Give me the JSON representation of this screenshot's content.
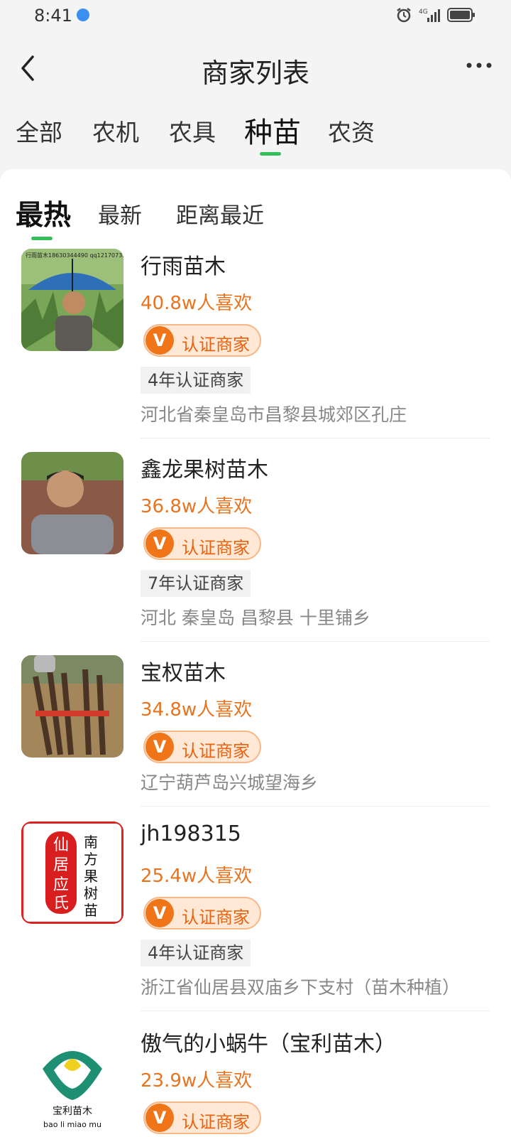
{
  "status": {
    "time": "8:41",
    "network": "4G"
  },
  "header": {
    "title": "商家列表"
  },
  "categories": [
    {
      "label": "全部",
      "active": false
    },
    {
      "label": "农机",
      "active": false
    },
    {
      "label": "农具",
      "active": false
    },
    {
      "label": "种苗",
      "active": true
    },
    {
      "label": "农资",
      "active": false
    }
  ],
  "sort_tabs": [
    {
      "label": "最热",
      "active": true
    },
    {
      "label": "最新",
      "active": false
    },
    {
      "label": "距离最近",
      "active": false
    }
  ],
  "merchants": [
    {
      "name": "行雨苗木",
      "likes": "40.8w人喜欢",
      "badge_v": "V",
      "badge": "认证商家",
      "years": "4年认证商家",
      "address": "河北省秦皇岛市昌黎县城郊区孔庄",
      "avatar_text": "行雨苗木18630344490 qq1217073555"
    },
    {
      "name": "鑫龙果树苗木",
      "likes": "36.8w人喜欢",
      "badge_v": "V",
      "badge": "认证商家",
      "years": "7年认证商家",
      "address": "河北 秦皇岛 昌黎县 十里铺乡"
    },
    {
      "name": "宝权苗木",
      "likes": "34.8w人喜欢",
      "badge_v": "V",
      "badge": "认证商家",
      "address": "辽宁葫芦岛兴城望海乡"
    },
    {
      "name": "jh198315",
      "likes": "25.4w人喜欢",
      "badge_v": "V",
      "badge": "认证商家",
      "years": "4年认证商家",
      "address": "浙江省仙居县双庙乡下支村（苗木种植）",
      "avatar_seal": [
        "仙",
        "居",
        "应",
        "氏"
      ],
      "avatar_side": [
        "南",
        "方",
        "果",
        "树",
        "苗"
      ]
    },
    {
      "name": "傲气的小蜗牛（宝利苗木）",
      "likes": "23.9w人喜欢",
      "badge_v": "V",
      "badge": "认证商家",
      "avatar_logo": "宝利苗木",
      "avatar_pinyin": "bao li miao mu"
    }
  ],
  "colors": {
    "accent_green": "#33c05a",
    "likes_orange": "#e8741f",
    "badge_orange": "#f07418"
  }
}
